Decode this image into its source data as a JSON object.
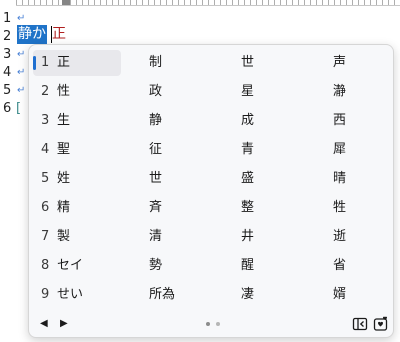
{
  "editor": {
    "line_numbers": [
      "1",
      "2",
      "3",
      "4",
      "5",
      "6"
    ],
    "line_marks": [
      "↵",
      "",
      "↵",
      "↵",
      "↵",
      "["
    ],
    "selected_text": "静か",
    "composition_text": "正"
  },
  "ime": {
    "numbers": [
      "1",
      "2",
      "3",
      "4",
      "5",
      "6",
      "7",
      "8",
      "9"
    ],
    "columns": [
      [
        "正",
        "性",
        "生",
        "聖",
        "姓",
        "精",
        "製",
        "セイ",
        "せい"
      ],
      [
        "制",
        "政",
        "静",
        "征",
        "世",
        "斉",
        "清",
        "勢",
        "所為"
      ],
      [
        "世",
        "星",
        "成",
        "青",
        "盛",
        "整",
        "井",
        "醒",
        "凄"
      ],
      [
        "声",
        "瀞",
        "西",
        "犀",
        "晴",
        "牲",
        "逝",
        "省",
        "婿"
      ]
    ],
    "selected_index": 0,
    "page_indicator": {
      "current": 1,
      "total": 2
    },
    "icons": {
      "prev": "triangle-left-icon",
      "next": "triangle-right-icon",
      "expand": "panel-expand-icon",
      "emoji": "emoji-heart-icon"
    },
    "colors": {
      "selection_bg": "#1f73c8",
      "composition": "#b02020",
      "accent": "#1f6fd0"
    }
  }
}
